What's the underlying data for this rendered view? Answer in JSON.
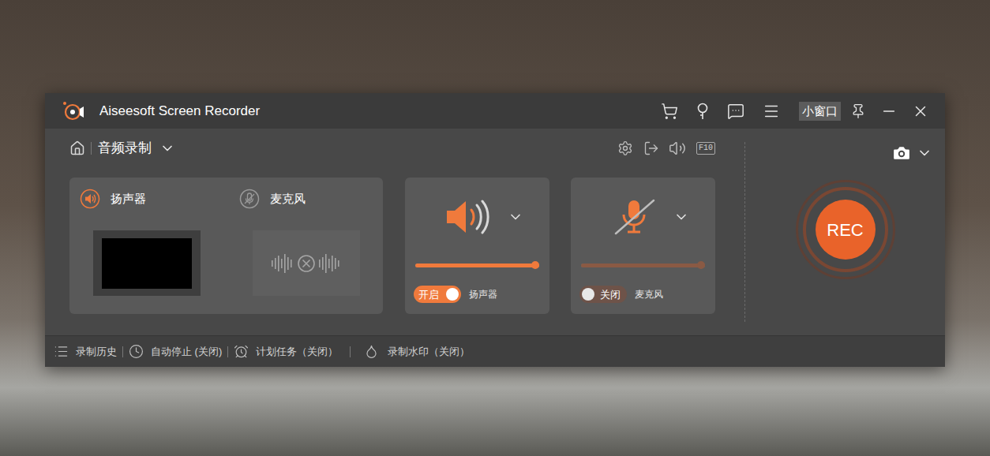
{
  "window": {
    "title": "Aiseesoft Screen Recorder",
    "mini_window_button": "小窗口"
  },
  "mode": {
    "label": "音频录制"
  },
  "toolbar": {
    "hotkey_badge": "F10"
  },
  "sources": [
    {
      "label": "扬声器",
      "active": true
    },
    {
      "label": "麦克风",
      "active": false
    }
  ],
  "controls": [
    {
      "kind": "speaker",
      "label": "扬声器",
      "toggle": "开启",
      "on": true,
      "level": 1.0
    },
    {
      "kind": "microphone",
      "label": "麦克风",
      "toggle": "关闭",
      "on": false,
      "level": 1.0
    }
  ],
  "record_button": "REC",
  "footer": [
    {
      "label": "录制历史"
    },
    {
      "label": "自动停止 (关闭)"
    },
    {
      "label": "计划任务（关闭）"
    },
    {
      "label": "录制水印（关闭）"
    }
  ]
}
